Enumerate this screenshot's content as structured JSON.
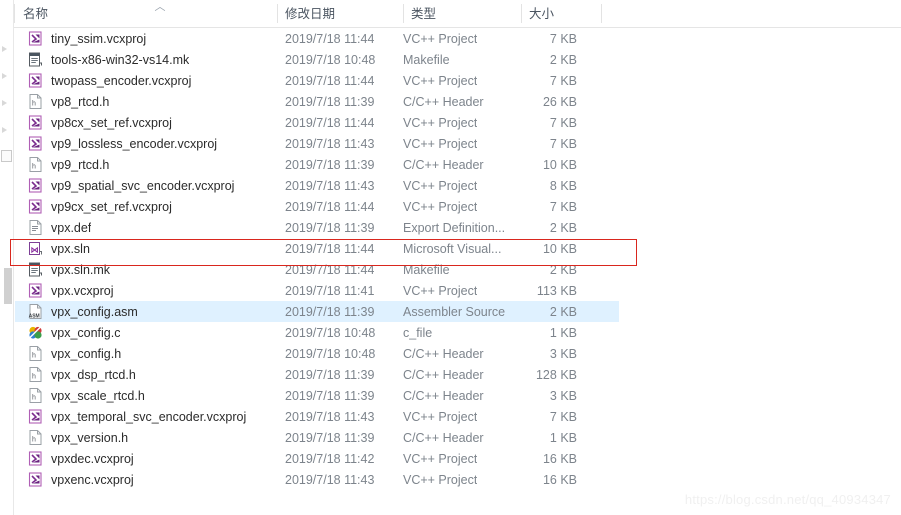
{
  "window": {
    "type": "file-explorer-list-view"
  },
  "columns": {
    "name": "名称",
    "date_modified": "修改日期",
    "type": "类型",
    "size": "大小",
    "sort_indicator": "︿",
    "sort_column": "名称",
    "sort_direction": "ascending"
  },
  "selection": {
    "selected_file": "vpx_config.asm",
    "selection_color": "#cce8ff"
  },
  "annotation": {
    "shape": "rectangle",
    "color": "#d9271e",
    "targets_row": "vpx.sln"
  },
  "watermark": {
    "text": "https://blog.csdn.net/qq_40934347"
  },
  "files": [
    {
      "name": "tiny_ssim.vcxproj",
      "date": "2019/7/18 11:44",
      "type": "VC++ Project",
      "size": "7 KB",
      "icon": "vcxproj-icon",
      "selected": false
    },
    {
      "name": "tools-x86-win32-vs14.mk",
      "date": "2019/7/18 10:48",
      "type": "Makefile",
      "size": "2 KB",
      "icon": "makefile-icon",
      "selected": false
    },
    {
      "name": "twopass_encoder.vcxproj",
      "date": "2019/7/18 11:44",
      "type": "VC++ Project",
      "size": "7 KB",
      "icon": "vcxproj-icon",
      "selected": false
    },
    {
      "name": "vp8_rtcd.h",
      "date": "2019/7/18 11:39",
      "type": "C/C++ Header",
      "size": "26 KB",
      "icon": "header-icon",
      "selected": false
    },
    {
      "name": "vp8cx_set_ref.vcxproj",
      "date": "2019/7/18 11:44",
      "type": "VC++ Project",
      "size": "7 KB",
      "icon": "vcxproj-icon",
      "selected": false
    },
    {
      "name": "vp9_lossless_encoder.vcxproj",
      "date": "2019/7/18 11:43",
      "type": "VC++ Project",
      "size": "7 KB",
      "icon": "vcxproj-icon",
      "selected": false
    },
    {
      "name": "vp9_rtcd.h",
      "date": "2019/7/18 11:39",
      "type": "C/C++ Header",
      "size": "10 KB",
      "icon": "header-icon",
      "selected": false
    },
    {
      "name": "vp9_spatial_svc_encoder.vcxproj",
      "date": "2019/7/18 11:43",
      "type": "VC++ Project",
      "size": "8 KB",
      "icon": "vcxproj-icon",
      "selected": false
    },
    {
      "name": "vp9cx_set_ref.vcxproj",
      "date": "2019/7/18 11:44",
      "type": "VC++ Project",
      "size": "7 KB",
      "icon": "vcxproj-icon",
      "selected": false
    },
    {
      "name": "vpx.def",
      "date": "2019/7/18 11:39",
      "type": "Export Definition...",
      "size": "2 KB",
      "icon": "def-icon",
      "selected": false
    },
    {
      "name": "vpx.sln",
      "date": "2019/7/18 11:44",
      "type": "Microsoft Visual...",
      "size": "10 KB",
      "icon": "sln-icon",
      "selected": false
    },
    {
      "name": "vpx.sln.mk",
      "date": "2019/7/18 11:44",
      "type": "Makefile",
      "size": "2 KB",
      "icon": "makefile-icon",
      "selected": false
    },
    {
      "name": "vpx.vcxproj",
      "date": "2019/7/18 11:41",
      "type": "VC++ Project",
      "size": "113 KB",
      "icon": "vcxproj-icon",
      "selected": false
    },
    {
      "name": "vpx_config.asm",
      "date": "2019/7/18 11:39",
      "type": "Assembler Source",
      "size": "2 KB",
      "icon": "asm-icon",
      "selected": true
    },
    {
      "name": "vpx_config.c",
      "date": "2019/7/18 10:48",
      "type": "c_file",
      "size": "1 KB",
      "icon": "cfile-icon",
      "selected": false
    },
    {
      "name": "vpx_config.h",
      "date": "2019/7/18 10:48",
      "type": "C/C++ Header",
      "size": "3 KB",
      "icon": "header-icon",
      "selected": false
    },
    {
      "name": "vpx_dsp_rtcd.h",
      "date": "2019/7/18 11:39",
      "type": "C/C++ Header",
      "size": "128 KB",
      "icon": "header-icon",
      "selected": false
    },
    {
      "name": "vpx_scale_rtcd.h",
      "date": "2019/7/18 11:39",
      "type": "C/C++ Header",
      "size": "3 KB",
      "icon": "header-icon",
      "selected": false
    },
    {
      "name": "vpx_temporal_svc_encoder.vcxproj",
      "date": "2019/7/18 11:43",
      "type": "VC++ Project",
      "size": "7 KB",
      "icon": "vcxproj-icon",
      "selected": false
    },
    {
      "name": "vpx_version.h",
      "date": "2019/7/18 11:39",
      "type": "C/C++ Header",
      "size": "1 KB",
      "icon": "header-icon",
      "selected": false
    },
    {
      "name": "vpxdec.vcxproj",
      "date": "2019/7/18 11:42",
      "type": "VC++ Project",
      "size": "16 KB",
      "icon": "vcxproj-icon",
      "selected": false
    },
    {
      "name": "vpxenc.vcxproj",
      "date": "2019/7/18 11:43",
      "type": "VC++ Project",
      "size": "16 KB",
      "icon": "vcxproj-icon",
      "selected": false
    }
  ]
}
